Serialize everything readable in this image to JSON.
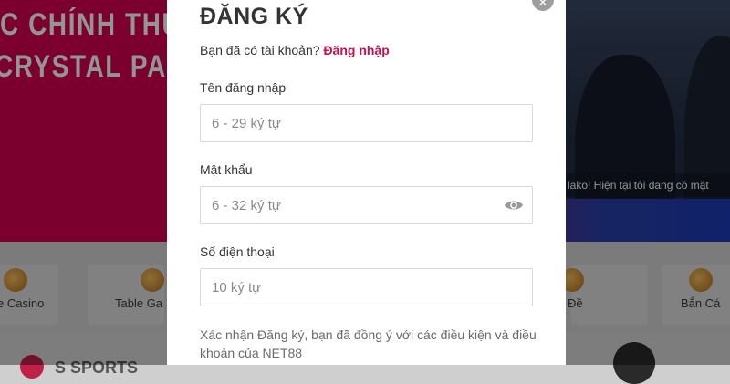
{
  "background": {
    "banner_line_1": "C CHÍNH THỨ",
    "banner_line_2": "CRYSTAL PA",
    "ticker": "lako!  Hiện tại tôi đang có mặt",
    "nav": [
      {
        "label": "e Casino",
        "icon": "casino-icon"
      },
      {
        "label": "Table Ga",
        "icon": "table-games-icon"
      },
      {
        "label": "Đề",
        "icon": "lottery-icon"
      },
      {
        "label": "Bắn Cá",
        "icon": "fish-shooting-icon"
      }
    ],
    "bottom_text": "S SPORTS",
    "colors": {
      "brand": "#d6004f",
      "link": "#c8104f"
    }
  },
  "modal": {
    "title": "ĐĂNG KÝ",
    "have_account_text": "Bạn đã có tài khoản?",
    "login_link": "Đăng nhập",
    "username": {
      "label": "Tên đăng nhập",
      "placeholder": "6 - 29 ký tự",
      "value": ""
    },
    "password": {
      "label": "Mật khẩu",
      "placeholder": "6 - 32 ký tự",
      "value": "",
      "toggle_icon": "eye-icon"
    },
    "phone": {
      "label": "Số điện thoại",
      "placeholder": "10 ký tự",
      "value": ""
    },
    "terms": "Xác nhận Đăng ký, bạn đã đồng ý với các điều kiện và điều khoản của NET88",
    "close_icon": "close-icon"
  }
}
